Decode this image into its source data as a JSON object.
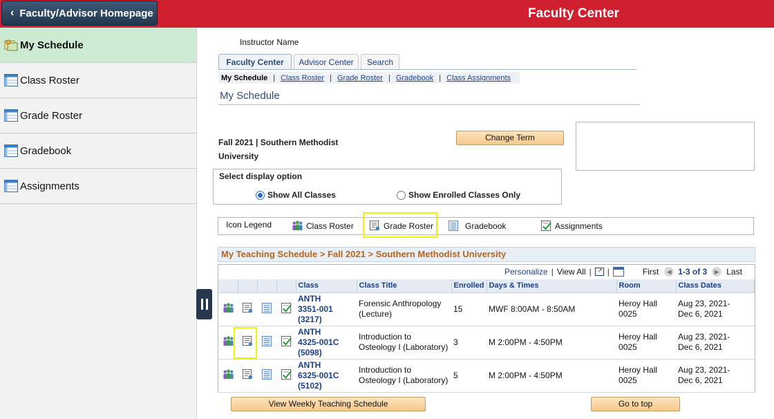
{
  "topbar": {
    "home_button": "Faculty/Advisor Homepage",
    "title": "Faculty Center"
  },
  "sidebar": {
    "items": [
      {
        "label": "My Schedule",
        "icon": "schedule-icon",
        "active": true
      },
      {
        "label": "Class Roster",
        "icon": "table-icon"
      },
      {
        "label": "Grade Roster",
        "icon": "table-icon"
      },
      {
        "label": "Gradebook",
        "icon": "table-icon"
      },
      {
        "label": "Assignments",
        "icon": "table-icon"
      }
    ]
  },
  "main": {
    "instructor_label": "Instructor Name",
    "tabs": [
      {
        "label": "Faculty Center",
        "active": true
      },
      {
        "label": "Advisor Center"
      },
      {
        "label": "Search"
      }
    ],
    "subnav": [
      "My Schedule",
      "Class Roster",
      "Grade Roster",
      "Gradebook",
      "Class Assignments"
    ],
    "page_title": "My Schedule",
    "term_line1": "Fall 2021 | Southern Methodist",
    "term_line2": "University",
    "change_term_button": "Change Term",
    "display_option": {
      "label": "Select display option",
      "options": [
        "Show All Classes",
        "Show Enrolled Classes Only"
      ],
      "selected": "Show All Classes"
    },
    "legend": {
      "title": "Icon Legend",
      "items": [
        "Class Roster",
        "Grade Roster",
        "Gradebook",
        "Assignments"
      ]
    },
    "schedule_header": "My Teaching Schedule > Fall 2021 > Southern Methodist University",
    "grid_nav": {
      "personalize": "Personalize",
      "view_all": "View All",
      "first": "First",
      "range": "1-3 of 3",
      "last": "Last"
    },
    "columns": [
      "Class",
      "Class Title",
      "Enrolled",
      "Days & Times",
      "Room",
      "Class Dates"
    ],
    "rows": [
      {
        "cls1": "ANTH",
        "cls2": "3351-001",
        "cls3": "(3217)",
        "title1": "Forensic Anthropology",
        "title2": "(Lecture)",
        "enrolled": "15",
        "days": "MWF 8:00AM - 8:50AM",
        "room1": "Heroy Hall",
        "room2": "0025",
        "dates1": "Aug 23, 2021-",
        "dates2": "Dec 6, 2021"
      },
      {
        "cls1": "ANTH",
        "cls2": "4325-001C",
        "cls3": "(5098)",
        "title1": "Introduction to",
        "title2": "Osteology I (Laboratory)",
        "enrolled": "3",
        "days": "M 2:00PM - 4:50PM",
        "room1": "Heroy Hall",
        "room2": "0025",
        "dates1": "Aug 23, 2021-",
        "dates2": "Dec 6, 2021"
      },
      {
        "cls1": "ANTH",
        "cls2": "6325-001C",
        "cls3": "(5102)",
        "title1": "Introduction to",
        "title2": "Osteology I (Laboratory)",
        "enrolled": "5",
        "days": "M 2:00PM - 4:50PM",
        "room1": "Heroy Hall",
        "room2": "0025",
        "dates1": "Aug 23, 2021-",
        "dates2": "Dec 6, 2021"
      }
    ],
    "view_weekly_button": "View Weekly Teaching Schedule",
    "go_to_top_button": "Go to top"
  },
  "colors": {
    "topbar": "#d01f2f",
    "home_button": "#2e4763",
    "active_sidebar": "#cdebd3",
    "highlight": "#f0f20a",
    "schedule_header_text": "#b8651a"
  }
}
